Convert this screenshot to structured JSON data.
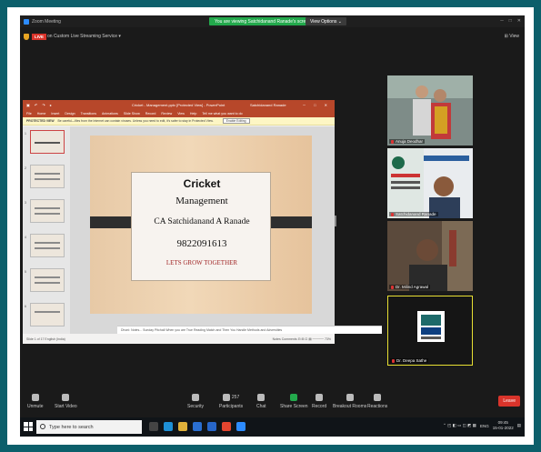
{
  "zoom": {
    "app_title": "Zoom Meeting",
    "share_banner": "You are viewing Satchidanand Ranade's screen",
    "view_options": "View Options ⌄",
    "live_label": "LIVE",
    "live_service": "on Custom Live Streaming Service ▾",
    "view_label": "⊞ View"
  },
  "ppt": {
    "window_title": "Cricket - Management.pptx [Protected View] - PowerPoint",
    "user": "Satchidanand Ranade",
    "menu": [
      "File",
      "Home",
      "Insert",
      "Design",
      "Transitions",
      "Animations",
      "Slide Show",
      "Record",
      "Review",
      "View",
      "Help",
      "Tell me what you want to do"
    ],
    "protected_label": "PROTECTED VIEW",
    "protected_text": "Be careful—files from the Internet can contain viruses. Unless you need to edit, it's safer to stay in Protected View.",
    "enable_editing": "Enable Editing",
    "thumb_numbers": [
      "1",
      "2",
      "3",
      "4",
      "5",
      "6"
    ],
    "notes_text": "Dhoni: Notes... Sunday Pitchall When you are True Reading Match and Then You Handle Methods and Adversities",
    "status_left": "Slide 1 of 17    English (India)",
    "status_right": "Notes    Comments    ⊟ ⊞ ⊡ ▤  ─────  73%"
  },
  "slide": {
    "title": "Cricket",
    "subtitle": "Management",
    "name": "CA Satchidanand A Ranade",
    "phone": "9822091613",
    "tagline": "LETS GROW TOGETHER"
  },
  "participants": [
    {
      "name": "Anuja Deodhar"
    },
    {
      "name": "Satchidanand Ranade"
    },
    {
      "name": "Dr. Milind Agrawal"
    },
    {
      "name": "Dr. Deepa Sathe"
    }
  ],
  "toolbar": {
    "unmute": "Unmute",
    "start_video": "Start Video",
    "security": "Security",
    "participants": "Participants",
    "participants_count": "257",
    "chat": "Chat",
    "share_screen": "Share Screen",
    "record": "Record",
    "breakout": "Breakout Rooms",
    "reactions": "Reactions",
    "leave": "Leave"
  },
  "taskbar": {
    "search_placeholder": "Type here to search",
    "lang": "ENG",
    "time": "09:45",
    "date": "15-01-2022"
  },
  "colors": {
    "frame": "#0c5f6b",
    "ppt_accent": "#b7472a",
    "share_green": "#23a94c",
    "leave_red": "#d9342b",
    "speaker_border": "#e8e033"
  }
}
